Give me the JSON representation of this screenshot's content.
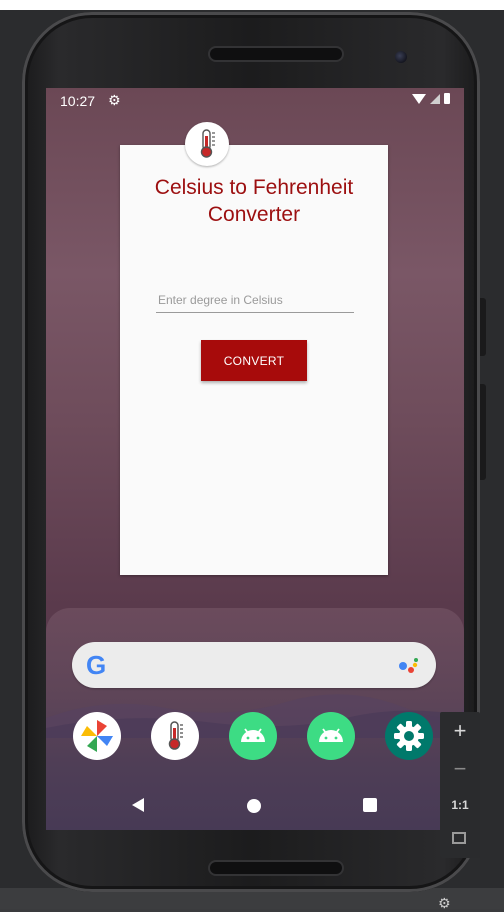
{
  "status_bar": {
    "time": "10:27",
    "settings_glyph": "⚙"
  },
  "card": {
    "title": "Celsius to Fehrenheit Converter",
    "input_placeholder": "Enter degree in Celsius",
    "input_value": "",
    "convert_label": "CONVERT"
  },
  "colors": {
    "accent": "#9c0f10",
    "button": "#a70b0b"
  },
  "search": {
    "logo": "G"
  },
  "dock": {
    "apps": [
      {
        "icon": "photos-pinwheel-icon"
      },
      {
        "icon": "thermometer-app-icon"
      },
      {
        "icon": "android-app-icon"
      },
      {
        "icon": "android-app-icon"
      },
      {
        "icon": "settings-gear-icon"
      }
    ]
  },
  "zoom": {
    "plus": "+",
    "minus": "−",
    "ratio": "1:1"
  }
}
